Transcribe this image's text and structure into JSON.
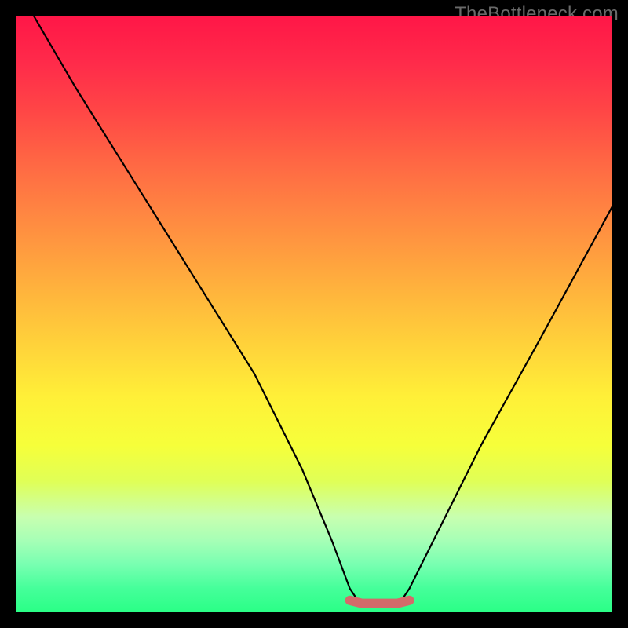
{
  "watermark": {
    "text": "TheBottleneck.com"
  },
  "chart_data": {
    "type": "line",
    "title": "",
    "xlabel": "",
    "ylabel": "",
    "xlim": [
      0,
      100
    ],
    "ylim": [
      0,
      100
    ],
    "series": [
      {
        "name": "curve",
        "x": [
          3,
          10,
          20,
          30,
          40,
          48,
          53,
          56,
          58,
          60,
          64,
          66,
          70,
          78,
          88,
          100
        ],
        "values": [
          100,
          88,
          72,
          56,
          40,
          24,
          12,
          4,
          1,
          1,
          1,
          4,
          12,
          28,
          46,
          68
        ]
      },
      {
        "name": "highlight-flat",
        "x": [
          56,
          58,
          60,
          62,
          64,
          66
        ],
        "values": [
          2,
          1.5,
          1.5,
          1.5,
          1.5,
          2
        ]
      }
    ],
    "background_gradient": {
      "top": "#ff1647",
      "mid": "#ffd53a",
      "bottom": "#2aff86"
    },
    "highlight_color": "#d46a6a"
  }
}
